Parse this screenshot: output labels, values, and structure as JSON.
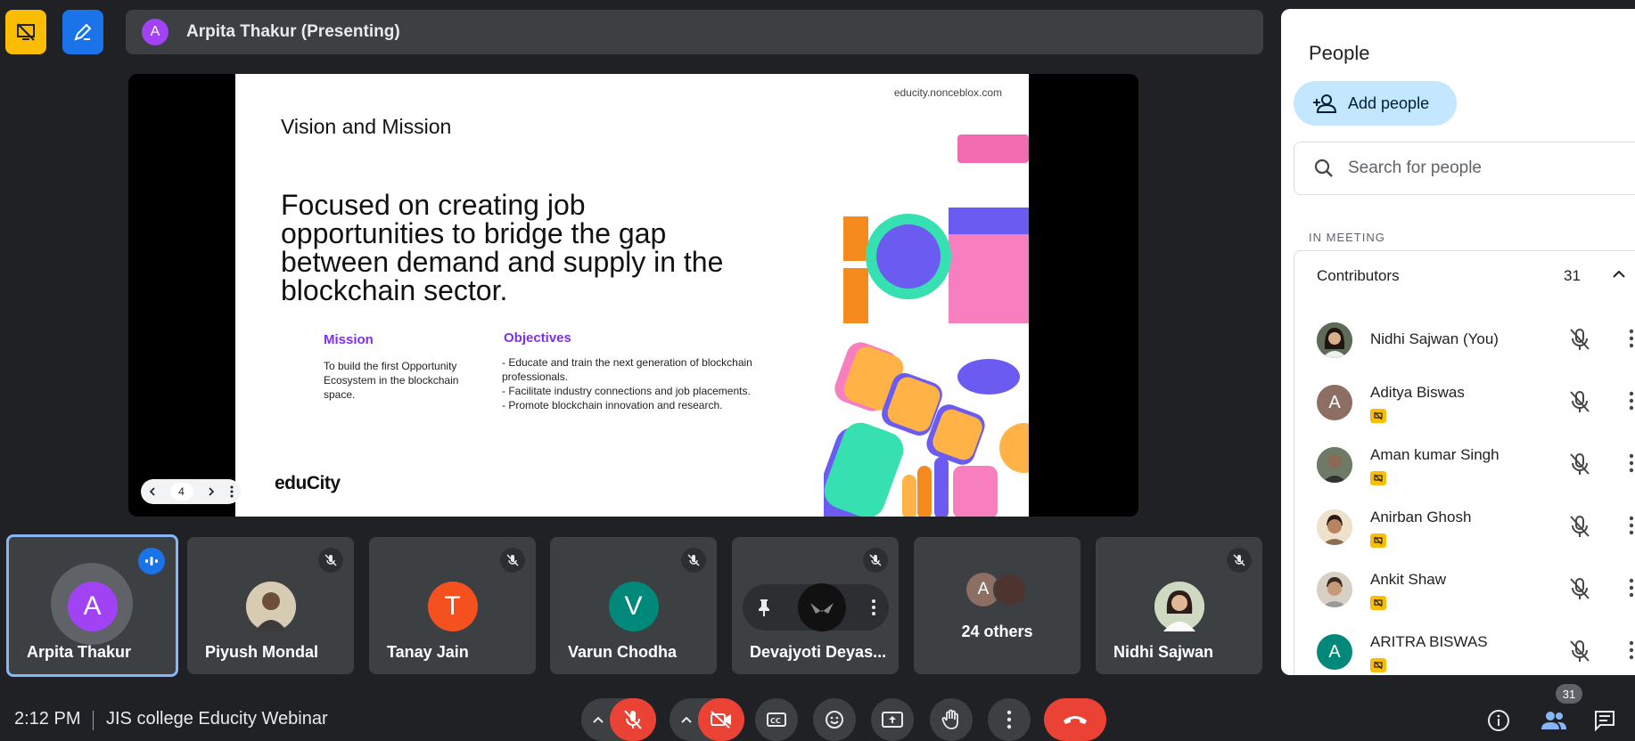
{
  "topbar": {
    "presenter_initial": "A",
    "presenter_text": "Arpita Thakur (Presenting)"
  },
  "slide": {
    "url": "educity.nonceblox.com",
    "title": "Vision and Mission",
    "headline": "Focused on creating job opportunities to bridge the gap between demand and supply in the blockchain sector.",
    "mission_title": "Mission",
    "mission_body": "To build the first Opportunity Ecosystem in the blockchain space.",
    "objectives_title": "Objectives",
    "objectives": [
      "- Educate and train the next generation of blockchain professionals.",
      "- Facilitate industry connections and job placements.",
      "- Promote blockchain innovation and research."
    ],
    "logo": "eduCity",
    "page_number": "4"
  },
  "tiles": [
    {
      "name": "Arpita Thakur",
      "initial": "A",
      "color": "#a142f4"
    },
    {
      "name": "Piyush Mondal"
    },
    {
      "name": "Tanay Jain",
      "initial": "T",
      "color": "#f4511e"
    },
    {
      "name": "Varun Chodha",
      "initial": "V",
      "color": "#00897b"
    },
    {
      "name": "Devajyoti Deyas..."
    },
    {
      "name": "24 others",
      "initial": "A"
    },
    {
      "name": "Nidhi Sajwan"
    }
  ],
  "panel": {
    "title": "People",
    "add_people": "Add people",
    "search_placeholder": "Search for people",
    "section": "IN MEETING",
    "contributors_label": "Contributors",
    "contributors_count": "31",
    "people": [
      {
        "name": "Nidhi Sajwan (You)"
      },
      {
        "name": "Aditya Biswas",
        "initial": "A",
        "color": "#8d6e63"
      },
      {
        "name": "Aman kumar Singh"
      },
      {
        "name": "Anirban Ghosh"
      },
      {
        "name": "Ankit Shaw"
      },
      {
        "name": "ARITRA BISWAS",
        "initial": "A",
        "color": "#00897b"
      }
    ]
  },
  "bottombar": {
    "time": "2:12 PM",
    "meeting_name": "JIS college Educity Webinar",
    "people_count": "31"
  },
  "colors": {
    "background": "#202124",
    "accent_blue": "#8ab4f8",
    "danger_red": "#ea4335",
    "warning_yellow": "#fbbc04"
  }
}
